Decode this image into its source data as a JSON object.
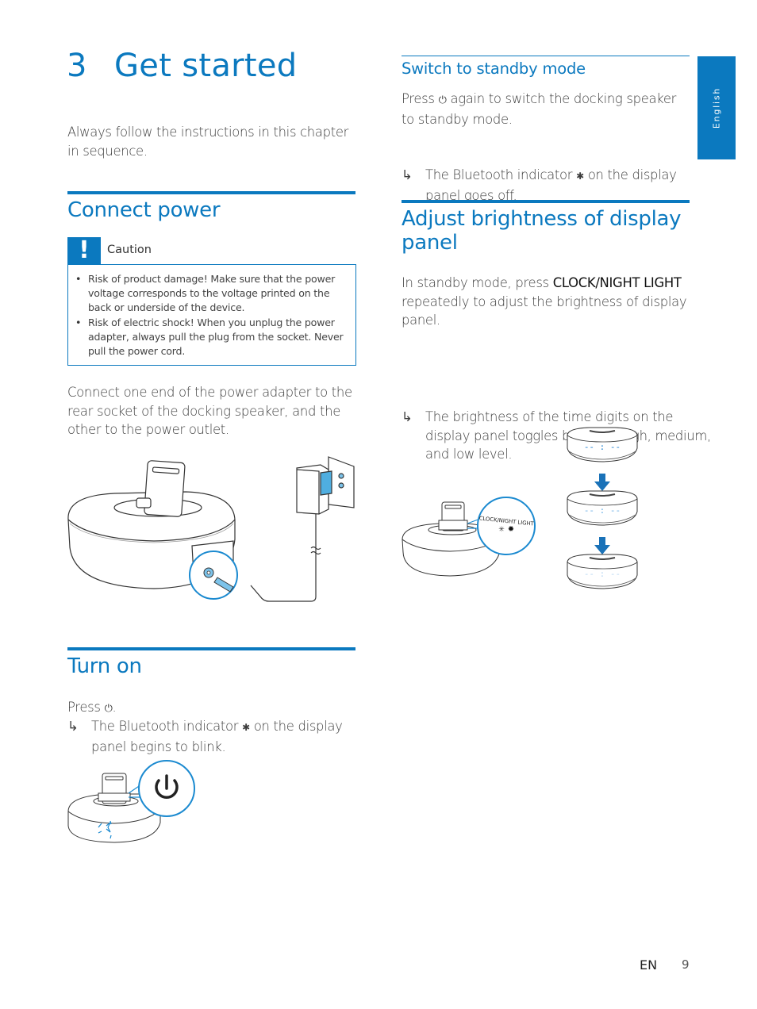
{
  "chapter": {
    "number": "3",
    "title": "Get started",
    "intro": "Always follow the instructions in this chapter in sequence."
  },
  "language_tab": {
    "label": "English"
  },
  "connect_power": {
    "heading": "Connect power",
    "caution": {
      "icon": "exclamation-icon",
      "label": "Caution",
      "items": [
        "Risk of product damage! Make sure that the power voltage corresponds to the voltage printed on the back or underside of the device.",
        "Risk of electric shock! When you unplug the power adapter, always pull the plug from the socket. Never pull the power cord."
      ]
    },
    "instruction": "Connect one end of the power adapter to the rear socket of the docking speaker, and the other to the power outlet.",
    "figure": {
      "description": "Docking speaker with power adapter plugged into wall socket",
      "icons": [
        "docking-speaker-illustration",
        "power-adapter-illustration",
        "wall-socket-illustration",
        "dc-plug-callout"
      ]
    }
  },
  "turn_on": {
    "heading": "Turn on",
    "step_prefix": "Press",
    "step_suffix": ".",
    "result_arrow": "↳",
    "result_text_before": "The Bluetooth indicator",
    "result_text_after": "on the display panel begins to blink.",
    "figure": {
      "description": "Docking speaker with power button callout and blinking Bluetooth indicator",
      "icons": [
        "power-icon",
        "bluetooth-icon"
      ]
    }
  },
  "standby": {
    "heading": "Switch to standby mode",
    "step_prefix": "Press",
    "step_suffix": "again to switch the docking speaker to standby mode.",
    "result_arrow": "↳",
    "result_text_before": "The Bluetooth indicator",
    "result_text_after": "on the display panel goes off."
  },
  "brightness": {
    "heading": "Adjust brightness of display panel",
    "step_before": "In standby mode, press",
    "step_button": "CLOCK/NIGHT LIGHT",
    "step_after": "repeatedly to adjust the brightness of display panel.",
    "result_arrow": "↳",
    "result_text": "The brightness of the time digits on the display panel toggles between high, medium, and low level.",
    "figure": {
      "callout_label": "CLOCK/NIGHT LIGHT",
      "display_text": "-- : --",
      "levels": [
        "high",
        "medium",
        "low"
      ],
      "level_colors": [
        "#1a7fd0",
        "#6aaee6",
        "#b7d6f2"
      ]
    }
  },
  "footer": {
    "language_code": "EN",
    "page_number": "9"
  }
}
